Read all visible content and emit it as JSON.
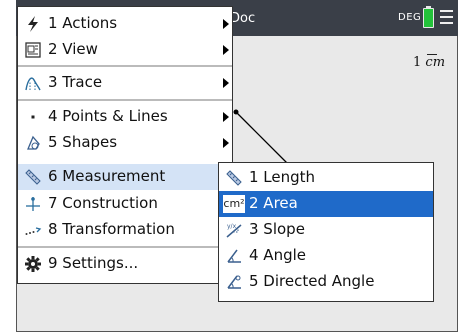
{
  "header": {
    "doc_title": "Doc",
    "angle_mode": "DEG"
  },
  "canvas": {
    "scale_value": "1",
    "scale_unit": "cm"
  },
  "main_menu": {
    "items": [
      {
        "label": "1  Actions",
        "icon": "lightning-icon"
      },
      {
        "label": "2  View",
        "icon": "view-icon"
      },
      {
        "label": "3  Trace",
        "icon": "trace-icon"
      },
      {
        "label": "4  Points & Lines",
        "icon": "point-icon"
      },
      {
        "label": "5  Shapes",
        "icon": "shapes-icon"
      },
      {
        "label": "6  Measurement",
        "icon": "ruler-icon"
      },
      {
        "label": "7  Construction",
        "icon": "construction-icon"
      },
      {
        "label": "8  Transformation",
        "icon": "transformation-icon"
      },
      {
        "label": "9  Settings...",
        "icon": "gear-icon"
      }
    ]
  },
  "sub_menu": {
    "items": [
      {
        "label": "1  Length",
        "icon": "ruler-icon"
      },
      {
        "label": "2  Area",
        "icon": "area-icon",
        "icon_text": "cm²"
      },
      {
        "label": "3  Slope",
        "icon": "slope-icon"
      },
      {
        "label": "4  Angle",
        "icon": "angle-icon"
      },
      {
        "label": "5  Directed Angle",
        "icon": "directed-angle-icon"
      }
    ]
  },
  "colors": {
    "highlight": "#1f6ac9",
    "selected": "#d4e3f6",
    "topbar": "#3a3f48",
    "battery": "#23c23a"
  }
}
